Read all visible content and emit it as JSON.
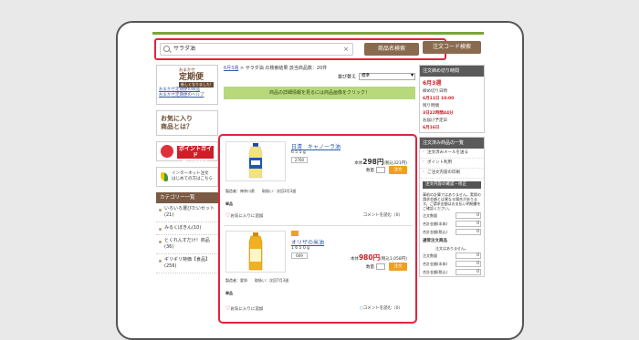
{
  "search": {
    "value": "サラダ油",
    "clear": "×",
    "name_button": "商品名検索",
    "code_button": "注文コード検索"
  },
  "left": {
    "teiki": {
      "small": "おまかせ",
      "big": "定期便",
      "tag": "新しくなりました!",
      "link1": "おまかせ定期便の商品",
      "link2": "おまかせ定期便のヘルプ"
    },
    "favorites": {
      "line1": "お気に入り",
      "line2": "商品とは？"
    },
    "points": {
      "line1": "ポイントガイド",
      "line2": "詳しくはこちら"
    },
    "beginner": {
      "line1": "インターネット注文",
      "line2": "はじめての方はこちら"
    },
    "category": {
      "heading": "カテゴリー一覧",
      "items": [
        "いろいろ選びたいセット(21)",
        "みるくぼきん(10)",
        "とくれんすだけ！商品(36)",
        "ギリギリ特価【食品】(256)"
      ]
    }
  },
  "center": {
    "crumb_week": "6月3週",
    "crumb_text": " > サラダ油 の検索結果 該当商品数：20件",
    "sort_label": "並び替え",
    "sort_value": "標準",
    "banner": "商品の詳細情報を見るには商品画像をクリック！",
    "products": [
      {
        "name": "日清　キャノーラ油",
        "size": "6 5 5 g",
        "code": "2760",
        "price_prefix": "本体",
        "price": "298円",
        "price_tax": "(税込321円)",
        "qty_label": "数量",
        "add_label": "注文",
        "maker": "製造者：神奈川県　　取扱い：次回3月3週",
        "tag": "単品",
        "fav": "お気に入りに追加",
        "review": "コメントを読む（0）"
      },
      {
        "name": "オリザの米油",
        "size": "1 6 5 0 g",
        "code": "609",
        "price_prefix": "本体",
        "price": "980円",
        "price_tax": "(税込1,058円)",
        "qty_label": "数量",
        "add_label": "注文",
        "maker": "製造者：愛知　　取扱い：次回7月3週",
        "tag": "単品",
        "fav": "お気に入りに追加",
        "review": "コメントを読む（0）"
      }
    ]
  },
  "right": {
    "deadline_head": "注文締め切り時間",
    "week": "6月3週",
    "close_label": "締め切り日時",
    "close_value": "6月11日 10:00",
    "remain_label": "残り時間",
    "remain_value": "3日22時間44分",
    "delivery_label": "お届け予定日",
    "delivery_value": "6月16日",
    "list_head": "注文済み商品の一覧",
    "links": [
      "注文済みメールを送る",
      "ポイント利用",
      "ご注文内容の印刷"
    ],
    "sum_head": "注文内容の確認・修正",
    "note": "事前の計算ではありません。実際の請求金額とは異なる場合があります。ご請求金額はお支払い明細書をご確認ください。",
    "rows": [
      {
        "label": "注文数量",
        "value": "0"
      },
      {
        "label": "合計金額(本体)",
        "value": "0"
      },
      {
        "label": "合計金額(税込)",
        "value": "0"
      }
    ],
    "regular_head": "通常注文商品",
    "regular_note": "注文はありません。",
    "rows2": [
      {
        "label": "注文数量",
        "value": "0"
      },
      {
        "label": "合計金額(本体)",
        "value": "0"
      },
      {
        "label": "合計金額(税込)",
        "value": "0"
      }
    ]
  }
}
